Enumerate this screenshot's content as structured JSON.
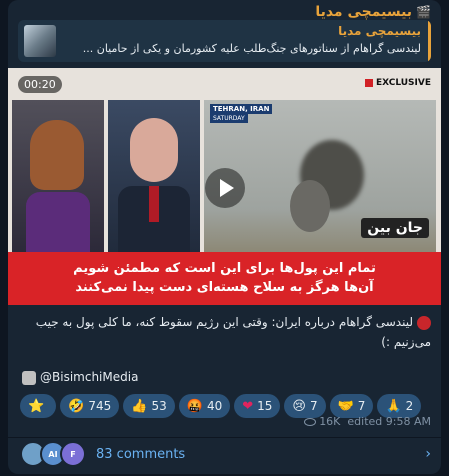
{
  "channel": {
    "name": "بیسیمچی مدیا",
    "icon": "camera-icon"
  },
  "reply": {
    "title": "بیسیمچی مدیا",
    "text": "لیندسی گراهام از سناتورهای جنگ‌طلب علیه کشورمان و یکی از حامیان ..."
  },
  "video": {
    "duration": "00:20",
    "exclusive": "EXCLUSIVE",
    "location_label": "TEHRAN, IRAN",
    "day_label": "SATURDAY",
    "logo": "جان بین",
    "caption_line1": "تمام این پول‌ها برای این است که مطمئن شویم",
    "caption_line2": "آن‌ها هرگز به سلاح هسته‌ای دست پیدا نمی‌کنند"
  },
  "message": {
    "text": "لیندسی گراهام درباره ایران: وقتی این رژیم سقوط کنه، ما کلی پول به جیب می‌زنیم :)"
  },
  "handle": "@BisimchiMedia",
  "reactions": [
    {
      "icon": "⭐",
      "count": ""
    },
    {
      "icon": "🤣",
      "count": "745"
    },
    {
      "icon": "👍",
      "count": "53"
    },
    {
      "icon": "🤬",
      "count": "40"
    },
    {
      "icon": "❤",
      "count": "15"
    },
    {
      "icon": "😢",
      "count": "7"
    },
    {
      "icon": "🤝",
      "count": "7"
    },
    {
      "icon": "🙏",
      "count": "2"
    }
  ],
  "meta": {
    "views": "16K",
    "edited": "edited 9:58 AM"
  },
  "comments": {
    "count_label": "83 comments",
    "avatars": [
      "",
      "AI",
      "F"
    ]
  },
  "colors": {
    "accent": "#e8a33b",
    "link": "#6ab2f2",
    "band": "#d92327"
  }
}
